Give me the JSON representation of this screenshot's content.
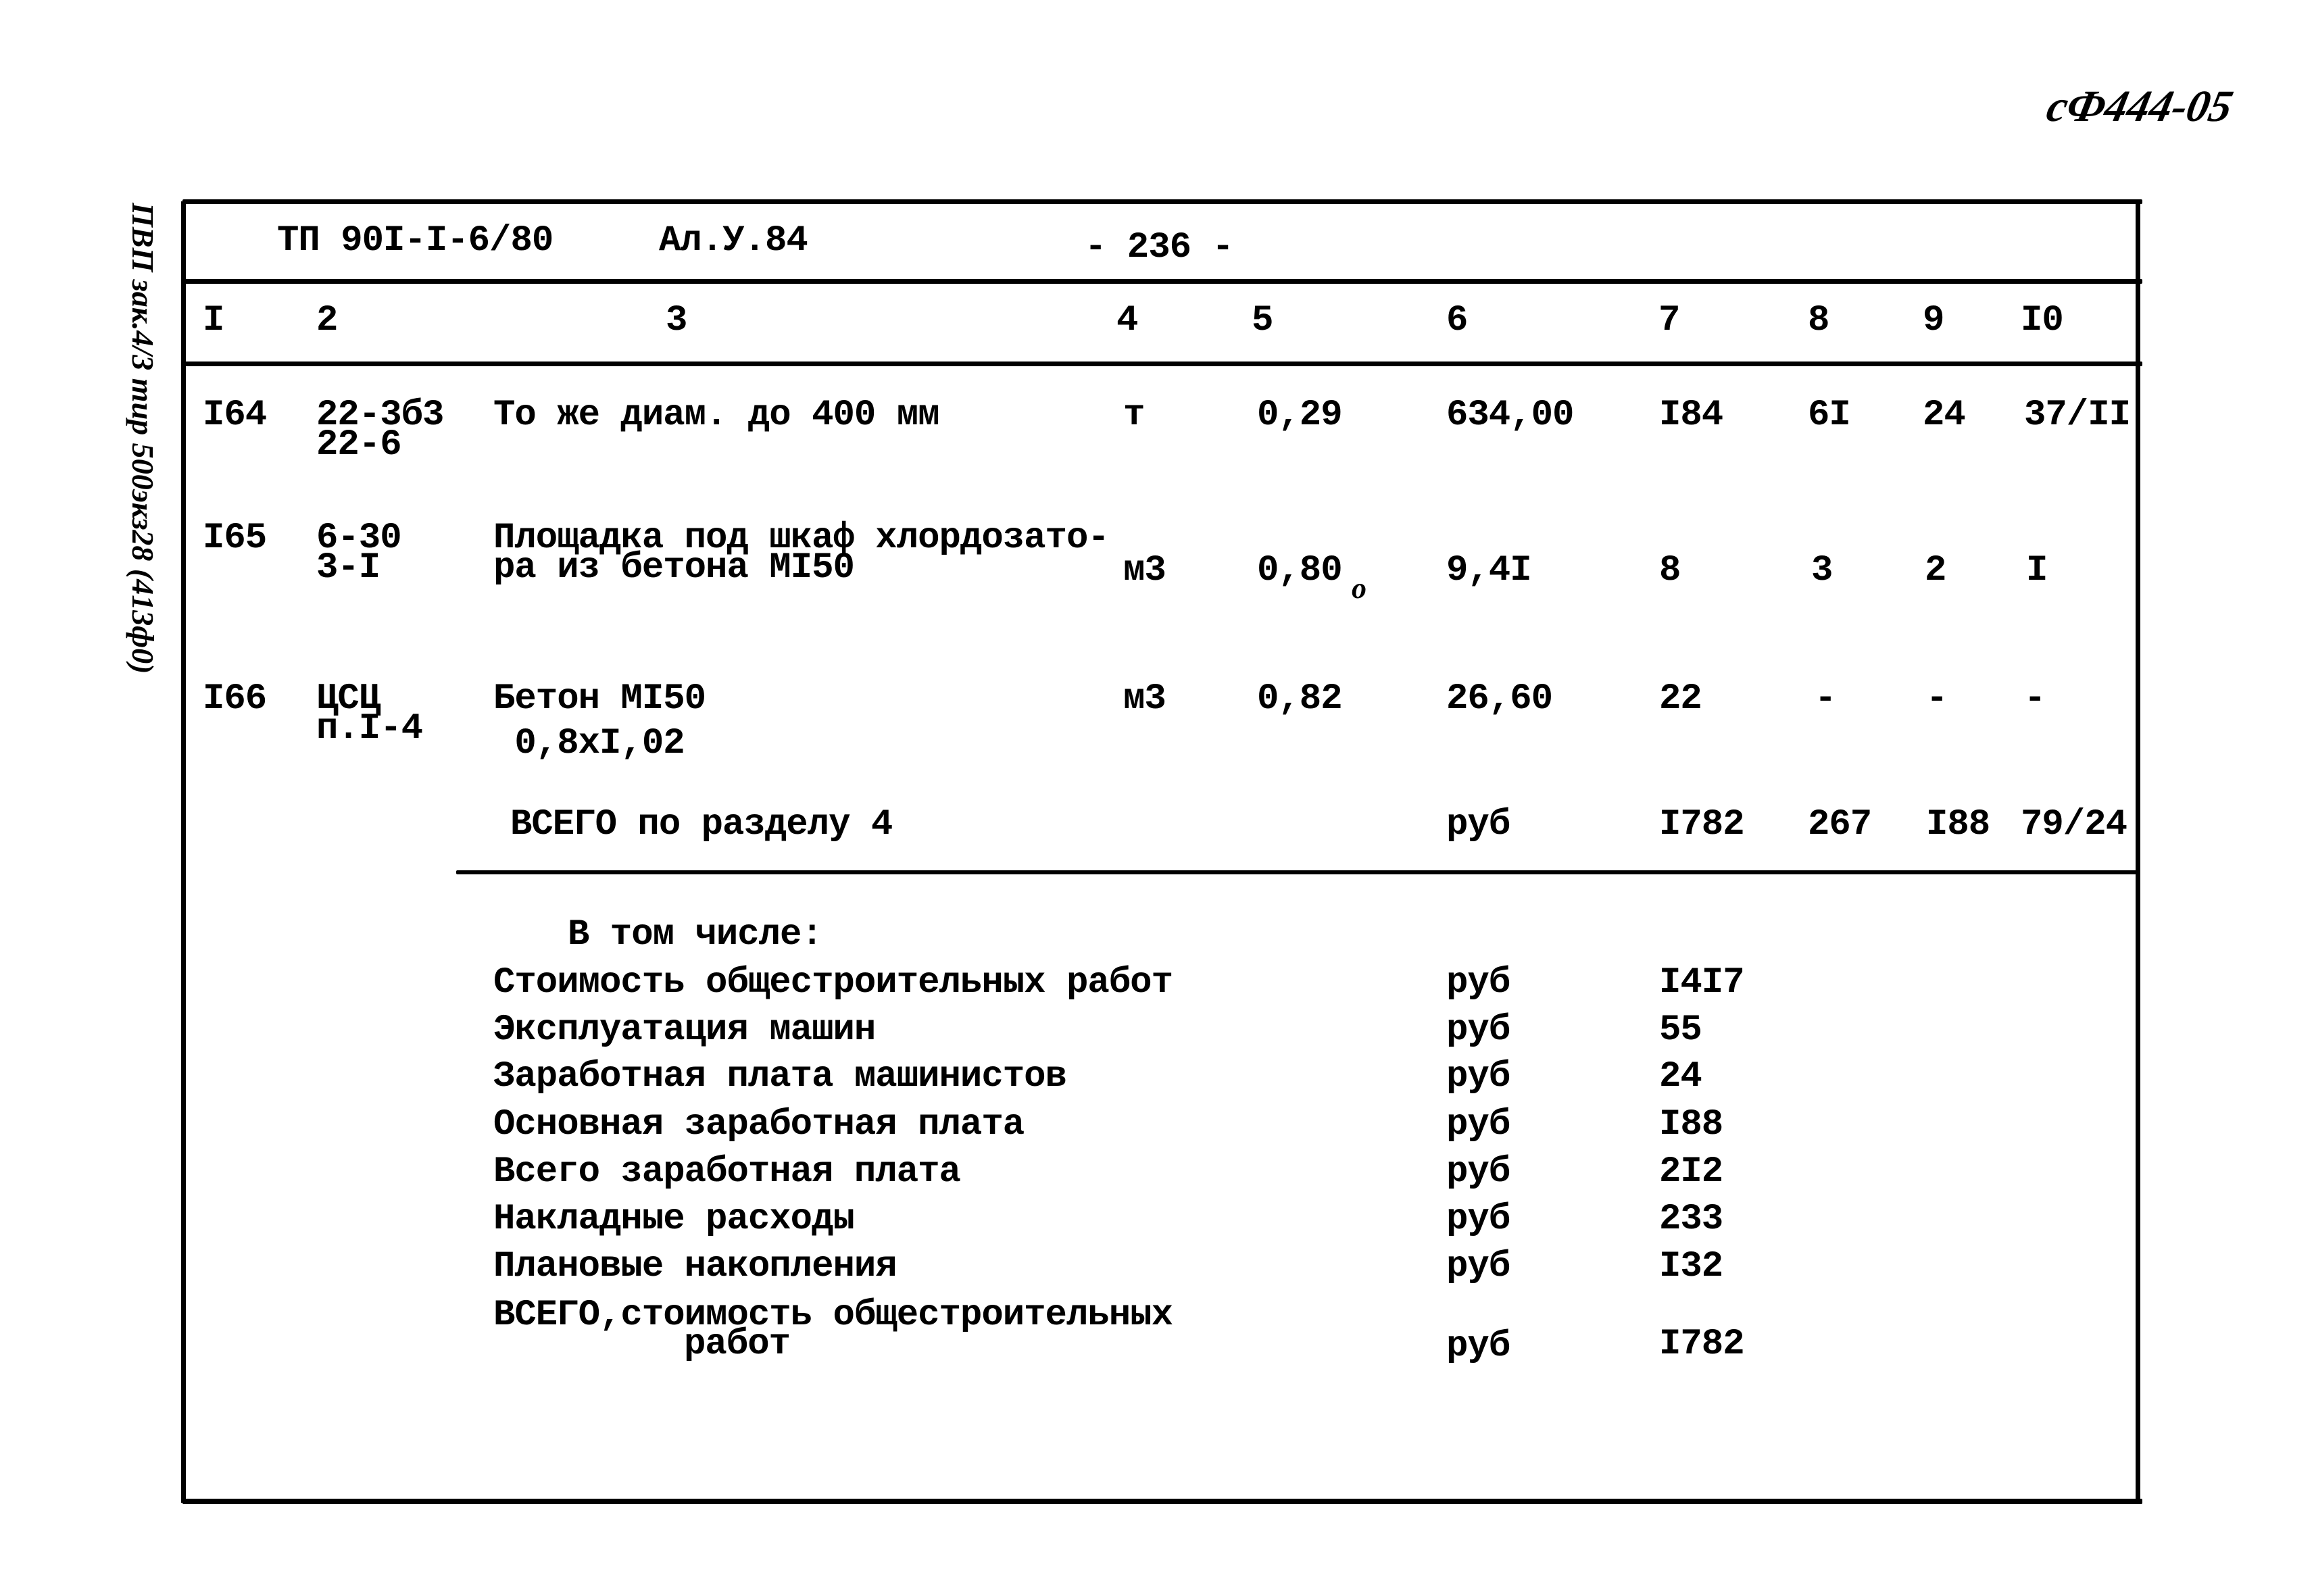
{
  "stamp": "сФ444-05",
  "side_note": "ПВП зак.4/3 тир 500экз28 (413ф0)",
  "header": {
    "doc_code": "ТП 90I-I-6/80",
    "album": "Ал.У.84",
    "page": "- 236 -"
  },
  "columns": [
    "I",
    "2",
    "3",
    "4",
    "5",
    "6",
    "7",
    "8",
    "9",
    "I0"
  ],
  "rows": [
    {
      "num": "I64",
      "code": [
        "22-3б3",
        "22-6"
      ],
      "name": [
        "То же диам. до 400 мм"
      ],
      "unit": "т",
      "qty": "0,29",
      "price": "634,00",
      "total": "I84",
      "c8": "6I",
      "c9": "24",
      "c10": "37/II"
    },
    {
      "num": "I65",
      "code": [
        "6-30",
        "3-I"
      ],
      "name": [
        "Площадка под шкаф хлордозато-",
        "ра из бетона МI50"
      ],
      "unit": "м3",
      "qty": "0,80",
      "mark": "о",
      "price": "9,4I",
      "total": "8",
      "c8": "3",
      "c9": "2",
      "c10": "I"
    },
    {
      "num": "I66",
      "code": [
        "ЦСЦ",
        "п.I-4"
      ],
      "name": [
        "Бетон МI50",
        " 0,8xI,02"
      ],
      "unit": "м3",
      "qty": "0,82",
      "price": "26,60",
      "total": "22",
      "c8": "-",
      "c9": "-",
      "c10": "-"
    }
  ],
  "section_total": {
    "label": "ВСЕГО по разделу 4",
    "unit": "руб",
    "total": "I782",
    "c8": "267",
    "c9": "I88",
    "c10": "79/24"
  },
  "breakdown": {
    "heading": "В том числе:",
    "items": [
      {
        "label": "Стоимость общестроительных работ",
        "unit": "руб",
        "value": "I4I7"
      },
      {
        "label": "Эксплуатация машин",
        "unit": "руб",
        "value": "55"
      },
      {
        "label": "Заработная плата машинистов",
        "unit": "руб",
        "value": "24"
      },
      {
        "label": "Основная заработная плата",
        "unit": "руб",
        "value": "I88"
      },
      {
        "label": "Всего заработная плата",
        "unit": "руб",
        "value": "2I2"
      },
      {
        "label": "Накладные расходы",
        "unit": "руб",
        "value": "233"
      },
      {
        "label": "Плановые накопления",
        "unit": "руб",
        "value": "I32"
      }
    ],
    "grand_total": {
      "label_line1": "ВСЕГО,стоимость общестроительных",
      "label_line2": "работ",
      "unit": "руб",
      "value": "I782"
    }
  }
}
